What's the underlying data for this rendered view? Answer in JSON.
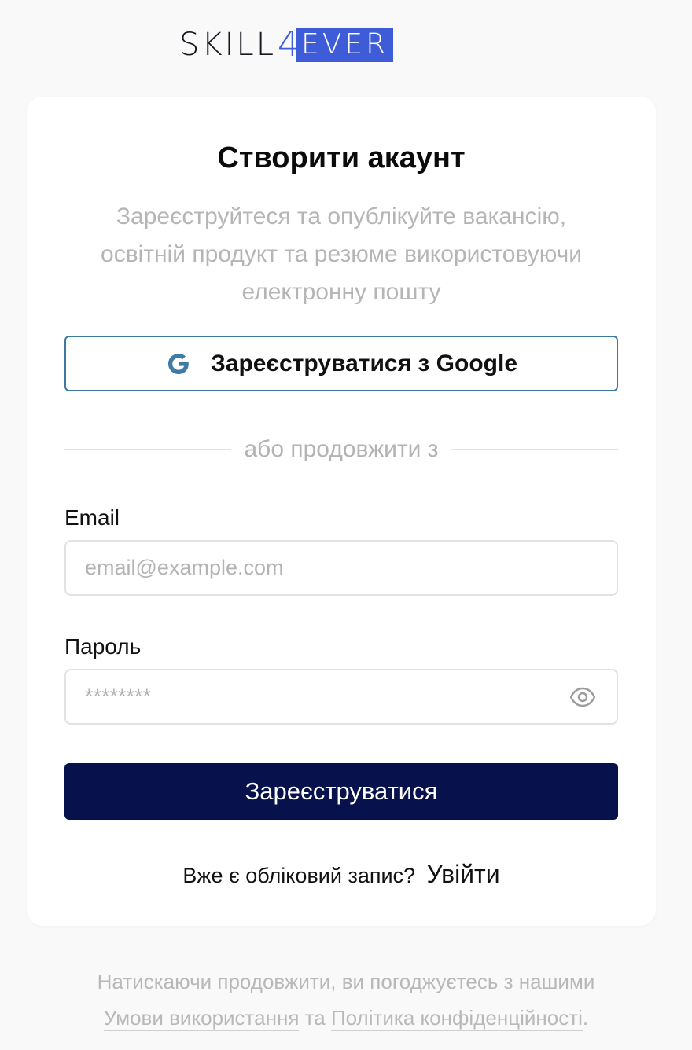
{
  "logo": {
    "left": "SKILL",
    "four": "4",
    "right": "EVER"
  },
  "signup": {
    "title": "Створити акаунт",
    "subtitle": "Зареєструйтеся та опублікуйте вакансію, освітній продукт та резюме використовуючи електронну пошту",
    "google_button_label": "Зареєструватися з Google",
    "divider_text": "або продовжити з",
    "email_label": "Email",
    "email_placeholder": "email@example.com",
    "email_value": "",
    "password_label": "Пароль",
    "password_placeholder": "********",
    "password_value": "",
    "submit_label": "Зареєструватися",
    "login_question": "Вже є обліковий запис?",
    "login_link": "Увійти"
  },
  "legal": {
    "prefix": "Натискаючи продовжити, ви погоджуєтесь з нашими",
    "terms_link": "Умови використання",
    "conjunction": "та",
    "privacy_link": "Політика конфіденційності",
    "suffix": "."
  },
  "colors": {
    "brand_blue": "#3e5bd8",
    "submit_bg": "#07124c",
    "google_border": "#3a78a0"
  },
  "icons": {
    "google": "google-g-icon",
    "eye": "eye-icon"
  }
}
